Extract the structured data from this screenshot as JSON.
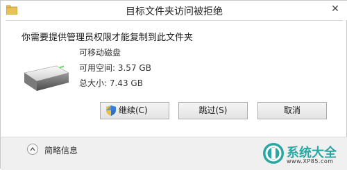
{
  "window": {
    "title": "目标文件夹访问被拒绝",
    "close_glyph": "✕"
  },
  "message": "你需要提供管理员权限才能复制到此文件夹",
  "drive": {
    "name": "可移动磁盘",
    "free_space": "可用空间: 3.57 GB",
    "total_size": "总大小: 7.43 GB"
  },
  "buttons": {
    "continue": "继续(C)",
    "skip": "跳过(S)",
    "cancel": "取消"
  },
  "footer": {
    "details_label": "简略信息"
  },
  "watermark": {
    "title": "系统大全",
    "url": "www.XP85.com"
  },
  "colors": {
    "watermark": "#2aa7a2",
    "footer_bg": "#f0f0f0"
  },
  "icons": {
    "title": "folder-icon",
    "drive": "removable-drive-icon",
    "continue": "uac-shield-icon",
    "details": "chevron-up-icon"
  }
}
